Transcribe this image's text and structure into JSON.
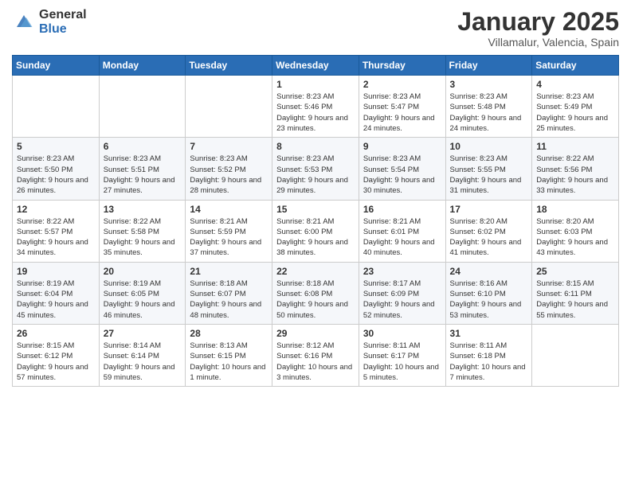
{
  "header": {
    "logo_general": "General",
    "logo_blue": "Blue",
    "month": "January 2025",
    "location": "Villamalur, Valencia, Spain"
  },
  "weekdays": [
    "Sunday",
    "Monday",
    "Tuesday",
    "Wednesday",
    "Thursday",
    "Friday",
    "Saturday"
  ],
  "weeks": [
    [
      {
        "day": "",
        "sunrise": "",
        "sunset": "",
        "daylight": ""
      },
      {
        "day": "",
        "sunrise": "",
        "sunset": "",
        "daylight": ""
      },
      {
        "day": "",
        "sunrise": "",
        "sunset": "",
        "daylight": ""
      },
      {
        "day": "1",
        "sunrise": "Sunrise: 8:23 AM",
        "sunset": "Sunset: 5:46 PM",
        "daylight": "Daylight: 9 hours and 23 minutes."
      },
      {
        "day": "2",
        "sunrise": "Sunrise: 8:23 AM",
        "sunset": "Sunset: 5:47 PM",
        "daylight": "Daylight: 9 hours and 24 minutes."
      },
      {
        "day": "3",
        "sunrise": "Sunrise: 8:23 AM",
        "sunset": "Sunset: 5:48 PM",
        "daylight": "Daylight: 9 hours and 24 minutes."
      },
      {
        "day": "4",
        "sunrise": "Sunrise: 8:23 AM",
        "sunset": "Sunset: 5:49 PM",
        "daylight": "Daylight: 9 hours and 25 minutes."
      }
    ],
    [
      {
        "day": "5",
        "sunrise": "Sunrise: 8:23 AM",
        "sunset": "Sunset: 5:50 PM",
        "daylight": "Daylight: 9 hours and 26 minutes."
      },
      {
        "day": "6",
        "sunrise": "Sunrise: 8:23 AM",
        "sunset": "Sunset: 5:51 PM",
        "daylight": "Daylight: 9 hours and 27 minutes."
      },
      {
        "day": "7",
        "sunrise": "Sunrise: 8:23 AM",
        "sunset": "Sunset: 5:52 PM",
        "daylight": "Daylight: 9 hours and 28 minutes."
      },
      {
        "day": "8",
        "sunrise": "Sunrise: 8:23 AM",
        "sunset": "Sunset: 5:53 PM",
        "daylight": "Daylight: 9 hours and 29 minutes."
      },
      {
        "day": "9",
        "sunrise": "Sunrise: 8:23 AM",
        "sunset": "Sunset: 5:54 PM",
        "daylight": "Daylight: 9 hours and 30 minutes."
      },
      {
        "day": "10",
        "sunrise": "Sunrise: 8:23 AM",
        "sunset": "Sunset: 5:55 PM",
        "daylight": "Daylight: 9 hours and 31 minutes."
      },
      {
        "day": "11",
        "sunrise": "Sunrise: 8:22 AM",
        "sunset": "Sunset: 5:56 PM",
        "daylight": "Daylight: 9 hours and 33 minutes."
      }
    ],
    [
      {
        "day": "12",
        "sunrise": "Sunrise: 8:22 AM",
        "sunset": "Sunset: 5:57 PM",
        "daylight": "Daylight: 9 hours and 34 minutes."
      },
      {
        "day": "13",
        "sunrise": "Sunrise: 8:22 AM",
        "sunset": "Sunset: 5:58 PM",
        "daylight": "Daylight: 9 hours and 35 minutes."
      },
      {
        "day": "14",
        "sunrise": "Sunrise: 8:21 AM",
        "sunset": "Sunset: 5:59 PM",
        "daylight": "Daylight: 9 hours and 37 minutes."
      },
      {
        "day": "15",
        "sunrise": "Sunrise: 8:21 AM",
        "sunset": "Sunset: 6:00 PM",
        "daylight": "Daylight: 9 hours and 38 minutes."
      },
      {
        "day": "16",
        "sunrise": "Sunrise: 8:21 AM",
        "sunset": "Sunset: 6:01 PM",
        "daylight": "Daylight: 9 hours and 40 minutes."
      },
      {
        "day": "17",
        "sunrise": "Sunrise: 8:20 AM",
        "sunset": "Sunset: 6:02 PM",
        "daylight": "Daylight: 9 hours and 41 minutes."
      },
      {
        "day": "18",
        "sunrise": "Sunrise: 8:20 AM",
        "sunset": "Sunset: 6:03 PM",
        "daylight": "Daylight: 9 hours and 43 minutes."
      }
    ],
    [
      {
        "day": "19",
        "sunrise": "Sunrise: 8:19 AM",
        "sunset": "Sunset: 6:04 PM",
        "daylight": "Daylight: 9 hours and 45 minutes."
      },
      {
        "day": "20",
        "sunrise": "Sunrise: 8:19 AM",
        "sunset": "Sunset: 6:05 PM",
        "daylight": "Daylight: 9 hours and 46 minutes."
      },
      {
        "day": "21",
        "sunrise": "Sunrise: 8:18 AM",
        "sunset": "Sunset: 6:07 PM",
        "daylight": "Daylight: 9 hours and 48 minutes."
      },
      {
        "day": "22",
        "sunrise": "Sunrise: 8:18 AM",
        "sunset": "Sunset: 6:08 PM",
        "daylight": "Daylight: 9 hours and 50 minutes."
      },
      {
        "day": "23",
        "sunrise": "Sunrise: 8:17 AM",
        "sunset": "Sunset: 6:09 PM",
        "daylight": "Daylight: 9 hours and 52 minutes."
      },
      {
        "day": "24",
        "sunrise": "Sunrise: 8:16 AM",
        "sunset": "Sunset: 6:10 PM",
        "daylight": "Daylight: 9 hours and 53 minutes."
      },
      {
        "day": "25",
        "sunrise": "Sunrise: 8:15 AM",
        "sunset": "Sunset: 6:11 PM",
        "daylight": "Daylight: 9 hours and 55 minutes."
      }
    ],
    [
      {
        "day": "26",
        "sunrise": "Sunrise: 8:15 AM",
        "sunset": "Sunset: 6:12 PM",
        "daylight": "Daylight: 9 hours and 57 minutes."
      },
      {
        "day": "27",
        "sunrise": "Sunrise: 8:14 AM",
        "sunset": "Sunset: 6:14 PM",
        "daylight": "Daylight: 9 hours and 59 minutes."
      },
      {
        "day": "28",
        "sunrise": "Sunrise: 8:13 AM",
        "sunset": "Sunset: 6:15 PM",
        "daylight": "Daylight: 10 hours and 1 minute."
      },
      {
        "day": "29",
        "sunrise": "Sunrise: 8:12 AM",
        "sunset": "Sunset: 6:16 PM",
        "daylight": "Daylight: 10 hours and 3 minutes."
      },
      {
        "day": "30",
        "sunrise": "Sunrise: 8:11 AM",
        "sunset": "Sunset: 6:17 PM",
        "daylight": "Daylight: 10 hours and 5 minutes."
      },
      {
        "day": "31",
        "sunrise": "Sunrise: 8:11 AM",
        "sunset": "Sunset: 6:18 PM",
        "daylight": "Daylight: 10 hours and 7 minutes."
      },
      {
        "day": "",
        "sunrise": "",
        "sunset": "",
        "daylight": ""
      }
    ]
  ]
}
